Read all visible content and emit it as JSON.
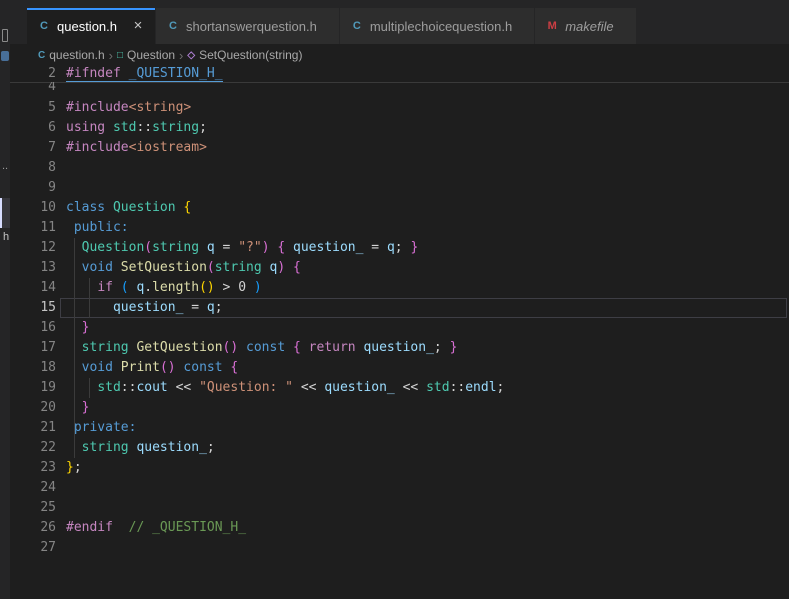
{
  "icons": {
    "close": "×",
    "chevron": "›"
  },
  "colors": {
    "accent_blue": "#3794ff",
    "c_file_icon": "#519aba",
    "makefile_icon": "#cc3e44",
    "class_icon": "#4ec9b0",
    "method_icon": "#b180d7"
  },
  "sidebar": {
    "dots_text": "..",
    "partial_letter": "h"
  },
  "tabs": [
    {
      "id": "question-h",
      "label": "question.h",
      "icon": "c-file",
      "icon_glyph": "C",
      "icon_color": "#519aba",
      "active": true,
      "close": true,
      "italic": false
    },
    {
      "id": "shortanswerquestion-h",
      "label": "shortanswerquestion.h",
      "icon": "c-file",
      "icon_glyph": "C",
      "icon_color": "#519aba",
      "active": false,
      "close": false,
      "italic": false
    },
    {
      "id": "multiplechoicequestion-h",
      "label": "multiplechoicequestion.h",
      "icon": "c-file",
      "icon_glyph": "C",
      "icon_color": "#519aba",
      "active": false,
      "close": false,
      "italic": false
    },
    {
      "id": "makefile",
      "label": "makefile",
      "icon": "makefile",
      "icon_glyph": "M",
      "icon_color": "#cc3e44",
      "active": false,
      "close": false,
      "italic": true
    }
  ],
  "breadcrumb": {
    "items": [
      {
        "label": "question.h",
        "icon": "c-file-icon",
        "glyph": "C",
        "color": "#519aba"
      },
      {
        "label": "Question",
        "icon": "symbol-class-icon",
        "glyph": "□",
        "color": "#4ec9b0"
      },
      {
        "label": "SetQuestion(string)",
        "icon": "symbol-method-icon",
        "glyph": "◇",
        "color": "#b180d7"
      }
    ]
  },
  "editor": {
    "sticky_line": {
      "num": 2,
      "tokens": [
        [
          "pre",
          "#ifndef"
        ],
        [
          "def",
          " "
        ],
        [
          "macro",
          "_QUESTION_H_"
        ]
      ]
    },
    "partial_line": {
      "num": 4,
      "tokens": []
    },
    "lines": [
      {
        "num": 5,
        "tokens": [
          [
            "pre",
            "#include"
          ],
          [
            "str",
            "<string>"
          ]
        ]
      },
      {
        "num": 6,
        "tokens": [
          [
            "pre",
            "using"
          ],
          [
            "def",
            " "
          ],
          [
            "type",
            "std"
          ],
          [
            "def",
            "::"
          ],
          [
            "type",
            "string"
          ],
          [
            "def",
            ";"
          ]
        ]
      },
      {
        "num": 7,
        "tokens": [
          [
            "pre",
            "#include"
          ],
          [
            "str",
            "<iostream>"
          ]
        ]
      },
      {
        "num": 8,
        "tokens": []
      },
      {
        "num": 9,
        "tokens": []
      },
      {
        "num": 10,
        "tokens": [
          [
            "kw",
            "class"
          ],
          [
            "def",
            " "
          ],
          [
            "type",
            "Question"
          ],
          [
            "def",
            " "
          ],
          [
            "b1",
            "{"
          ]
        ]
      },
      {
        "num": 11,
        "tokens": [
          [
            "def",
            " "
          ],
          [
            "kw",
            "public:"
          ]
        ]
      },
      {
        "num": 12,
        "tokens": [
          [
            "def",
            "  "
          ],
          [
            "type",
            "Question"
          ],
          [
            "b2",
            "("
          ],
          [
            "type",
            "string"
          ],
          [
            "def",
            " "
          ],
          [
            "var",
            "q"
          ],
          [
            "def",
            " = "
          ],
          [
            "str",
            "\"?\""
          ],
          [
            "b2",
            ")"
          ],
          [
            "def",
            " "
          ],
          [
            "b2",
            "{"
          ],
          [
            "def",
            " "
          ],
          [
            "var",
            "question_"
          ],
          [
            "def",
            " = "
          ],
          [
            "var",
            "q"
          ],
          [
            "def",
            "; "
          ],
          [
            "b2",
            "}"
          ]
        ]
      },
      {
        "num": 13,
        "tokens": [
          [
            "def",
            "  "
          ],
          [
            "kw",
            "void"
          ],
          [
            "def",
            " "
          ],
          [
            "fn",
            "SetQuestion"
          ],
          [
            "b2",
            "("
          ],
          [
            "type",
            "string"
          ],
          [
            "def",
            " "
          ],
          [
            "var",
            "q"
          ],
          [
            "b2",
            ")"
          ],
          [
            "def",
            " "
          ],
          [
            "b2",
            "{"
          ]
        ]
      },
      {
        "num": 14,
        "tokens": [
          [
            "def",
            "    "
          ],
          [
            "pre",
            "if"
          ],
          [
            "def",
            " "
          ],
          [
            "b3",
            "("
          ],
          [
            "def",
            " "
          ],
          [
            "var",
            "q"
          ],
          [
            "def",
            "."
          ],
          [
            "fn",
            "length"
          ],
          [
            "b1",
            "()"
          ],
          [
            "def",
            " > "
          ],
          [
            "num-lit",
            "0"
          ],
          [
            "def",
            " "
          ],
          [
            "b3",
            ")"
          ]
        ]
      },
      {
        "num": 15,
        "current": true,
        "tokens": [
          [
            "def",
            "      "
          ],
          [
            "var",
            "question_"
          ],
          [
            "def",
            " = "
          ],
          [
            "var",
            "q"
          ],
          [
            "def",
            ";"
          ]
        ]
      },
      {
        "num": 16,
        "tokens": [
          [
            "def",
            "  "
          ],
          [
            "b2",
            "}"
          ]
        ]
      },
      {
        "num": 17,
        "tokens": [
          [
            "def",
            "  "
          ],
          [
            "type",
            "string"
          ],
          [
            "def",
            " "
          ],
          [
            "fn",
            "GetQuestion"
          ],
          [
            "b2",
            "()"
          ],
          [
            "def",
            " "
          ],
          [
            "kw",
            "const"
          ],
          [
            "def",
            " "
          ],
          [
            "b2",
            "{"
          ],
          [
            "def",
            " "
          ],
          [
            "pre",
            "return"
          ],
          [
            "def",
            " "
          ],
          [
            "var",
            "question_"
          ],
          [
            "def",
            "; "
          ],
          [
            "b2",
            "}"
          ]
        ]
      },
      {
        "num": 18,
        "tokens": [
          [
            "def",
            "  "
          ],
          [
            "kw",
            "void"
          ],
          [
            "def",
            " "
          ],
          [
            "fn",
            "Print"
          ],
          [
            "b2",
            "()"
          ],
          [
            "def",
            " "
          ],
          [
            "kw",
            "const"
          ],
          [
            "def",
            " "
          ],
          [
            "b2",
            "{"
          ]
        ]
      },
      {
        "num": 19,
        "tokens": [
          [
            "def",
            "    "
          ],
          [
            "type",
            "std"
          ],
          [
            "def",
            "::"
          ],
          [
            "var",
            "cout"
          ],
          [
            "def",
            " << "
          ],
          [
            "str",
            "\"Question: \""
          ],
          [
            "def",
            " << "
          ],
          [
            "var",
            "question_"
          ],
          [
            "def",
            " << "
          ],
          [
            "type",
            "std"
          ],
          [
            "def",
            "::"
          ],
          [
            "var",
            "endl"
          ],
          [
            "def",
            ";"
          ]
        ]
      },
      {
        "num": 20,
        "tokens": [
          [
            "def",
            "  "
          ],
          [
            "b2",
            "}"
          ]
        ]
      },
      {
        "num": 21,
        "tokens": [
          [
            "def",
            " "
          ],
          [
            "kw",
            "private:"
          ]
        ]
      },
      {
        "num": 22,
        "tokens": [
          [
            "def",
            "  "
          ],
          [
            "type",
            "string"
          ],
          [
            "def",
            " "
          ],
          [
            "var",
            "question_"
          ],
          [
            "def",
            ";"
          ]
        ]
      },
      {
        "num": 23,
        "tokens": [
          [
            "b1",
            "}"
          ],
          [
            "def",
            ";"
          ]
        ]
      },
      {
        "num": 24,
        "tokens": []
      },
      {
        "num": 25,
        "tokens": []
      },
      {
        "num": 26,
        "tokens": [
          [
            "pre",
            "#endif"
          ],
          [
            "def",
            "  "
          ],
          [
            "cmt",
            "// _QUESTION_H_"
          ]
        ]
      },
      {
        "num": 27,
        "tokens": []
      }
    ]
  }
}
